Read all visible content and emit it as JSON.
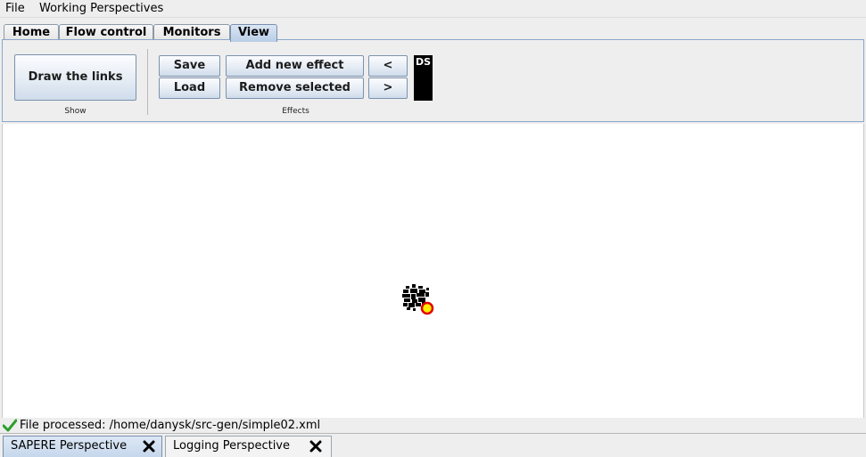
{
  "menubar": {
    "items": [
      "File",
      "Working Perspectives"
    ]
  },
  "tabs": [
    {
      "label": "Home"
    },
    {
      "label": "Flow control"
    },
    {
      "label": "Monitors"
    },
    {
      "label": "View",
      "active": true
    }
  ],
  "ribbon": {
    "show_group": {
      "draw_links_label": "Draw the links",
      "group_label": "Show"
    },
    "effects_group": {
      "save_label": "Save",
      "load_label": "Load",
      "add_effect_label": "Add new effect",
      "remove_selected_label": "Remove selected",
      "prev_label": "<",
      "next_label": ">",
      "ds_label": "DS",
      "group_label": "Effects"
    }
  },
  "canvas": {
    "background": "#ffffff",
    "node_colors": {
      "cluster": "#000000",
      "marker_fill": "#ffee00",
      "marker_ring": "#e00000"
    }
  },
  "statusbar": {
    "icon": "check-icon",
    "text": "File processed: /home/danysk/src-gen/simple02.xml"
  },
  "perspectives": [
    {
      "label": "SAPERE Perspective",
      "active": true
    },
    {
      "label": "Logging Perspective",
      "active": false
    }
  ]
}
